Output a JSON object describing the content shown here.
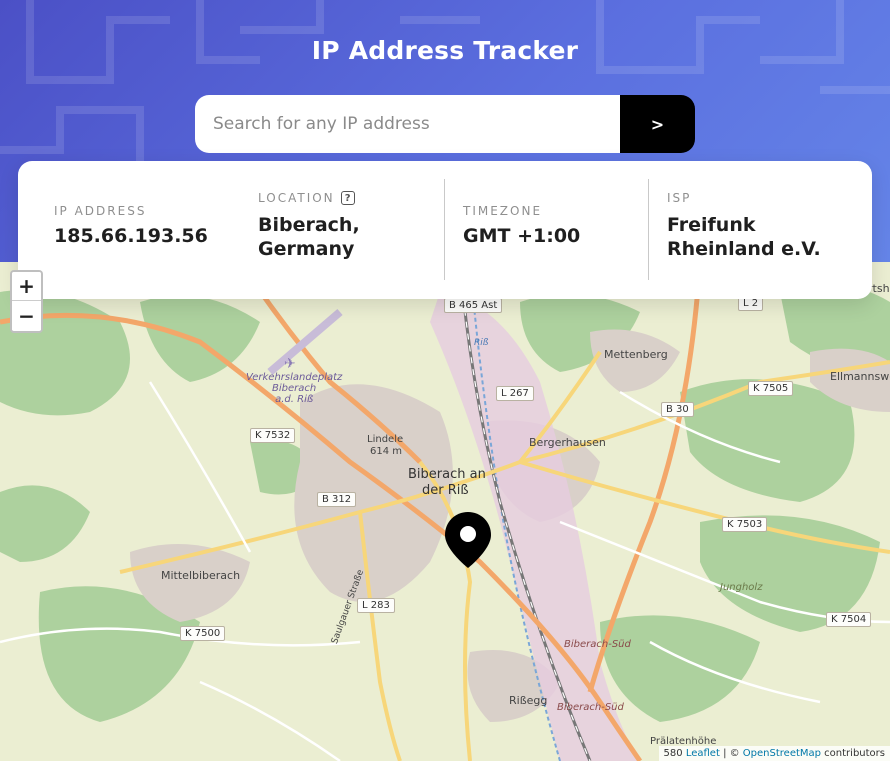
{
  "app": {
    "title": "IP Address Tracker"
  },
  "search": {
    "placeholder": "Search for any IP address",
    "value": "",
    "button_label": ">"
  },
  "info": {
    "ip": {
      "label": "IP ADDRESS",
      "value": "185.66.193.56"
    },
    "location": {
      "label": "LOCATION",
      "help_icon": "question-icon",
      "value_line1": "Biberach,",
      "value_line2": "Germany"
    },
    "timezone": {
      "label": "TIMEZONE",
      "value": "GMT +1:00"
    },
    "isp": {
      "label": "ISP",
      "value_line1": "Freifunk",
      "value_line2": "Rheinland e.V."
    }
  },
  "map": {
    "zoom_in": "+",
    "zoom_out": "−",
    "marker_icon": "location-pin-icon",
    "places": {
      "biberach_1": "Biberach an",
      "biberach_2": "der Riß",
      "mettenberg": "Mettenberg",
      "ellmannsweiler": "Ellmannswe",
      "bergerhausen": "Bergerhausen",
      "mittelbiberach": "Mittelbiberach",
      "rissegg": "Rißegg",
      "lindele_1": "Lindele",
      "lindele_2": "614 m",
      "jungholz": "Jungholz",
      "pralatenhohe": "Prälatenhöhe",
      "biberach_sud_1": "Biberach-Süd",
      "biberach_sud_2": "Biberach-Süd",
      "saulgauer": "Saulgauer Straße",
      "landeplatz_1": "Verkehrslandeplatz",
      "landeplatz_2": "Biberach",
      "landeplatz_3": "a.d. Riß",
      "riss_river": "Riß",
      "partial_right": "rtsh"
    },
    "roads": {
      "b465": "B 465 Ast",
      "l267": "L 267",
      "b30": "B 30",
      "k7505": "K 7505",
      "k7532": "K 7532",
      "b312": "B 312",
      "k7503": "K 7503",
      "l283": "L 283",
      "k7500": "K 7500",
      "k7504": "K 7504",
      "l2x": "L 2"
    },
    "attribution": {
      "prefix": "580",
      "leaflet": "Leaflet",
      "separator": " | © ",
      "osm": "OpenStreetMap",
      "suffix": " contributors"
    }
  }
}
